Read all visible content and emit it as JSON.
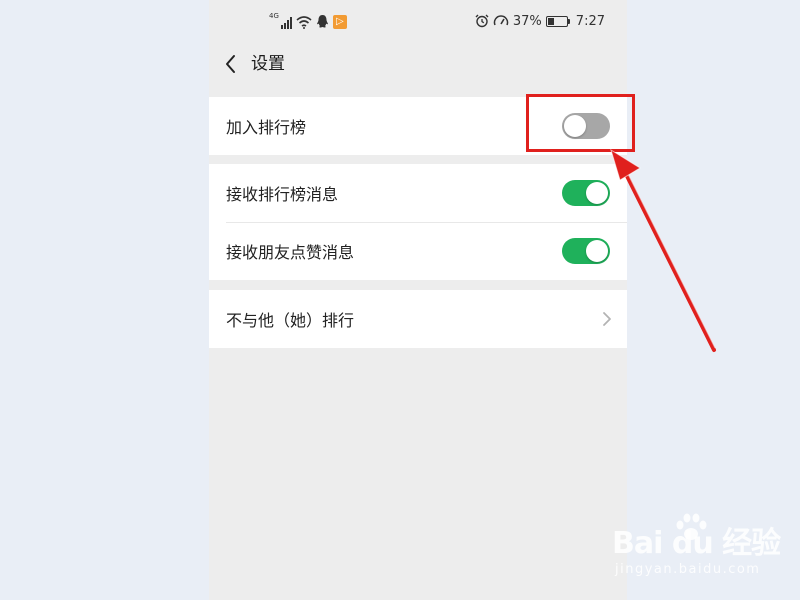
{
  "status_bar": {
    "network": "4G",
    "battery": "37%",
    "time": "7:27",
    "battery_level": 0.37,
    "icons": [
      "signal-icon",
      "wifi-icon",
      "qq-icon",
      "app-icon",
      "alarm-icon",
      "speed-icon",
      "battery-icon"
    ]
  },
  "header": {
    "title": "设置",
    "back_icon": "back-icon"
  },
  "groups": [
    {
      "items": [
        {
          "label": "加入排行榜",
          "control": "toggle",
          "on": false
        }
      ]
    },
    {
      "items": [
        {
          "label": "接收排行榜消息",
          "control": "toggle",
          "on": true
        },
        {
          "label": "接收朋友点赞消息",
          "control": "toggle",
          "on": true
        }
      ]
    },
    {
      "items": [
        {
          "label": "不与他（她）排行",
          "control": "chevron"
        }
      ]
    }
  ],
  "colors": {
    "toggle_on": "#1fb15b",
    "toggle_off": "#a7a7a7",
    "annotation": "#e0201d",
    "screen_bg": "#ededed",
    "outer_bg": "#e9eef6",
    "badge": "#f29b33"
  },
  "watermark": {
    "logo": "Bai du 经验",
    "url": "jingyan.baidu.com"
  }
}
